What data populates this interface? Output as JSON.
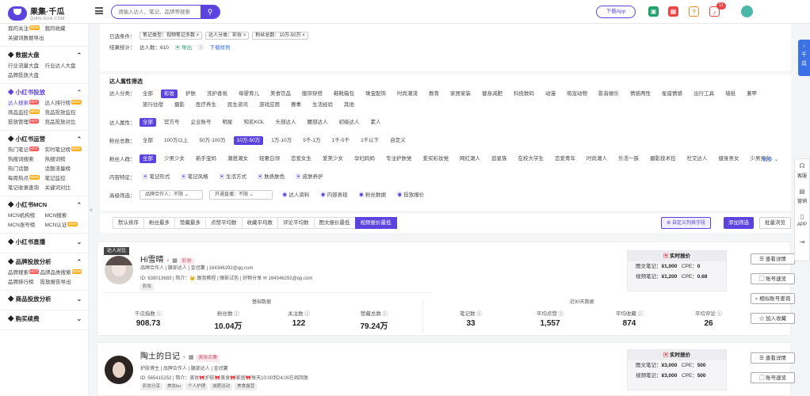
{
  "header": {
    "logo_name": "果集·千瓜",
    "logo_sub": "QIAN-GUA.COM",
    "search_placeholder": "请输入达人、笔记、品牌等搜索",
    "download_app": "下载App",
    "notification_count": "11"
  },
  "sidebar": {
    "groups": [
      {
        "title": "",
        "items": [
          {
            "label": "我的关注",
            "badge": "NEW"
          },
          {
            "label": "我的收藏",
            "badge": ""
          },
          {
            "label": "关键词数据导出",
            "badge": ""
          }
        ]
      },
      {
        "title": "数据大盘",
        "icon": "chart-icon",
        "items": [
          {
            "label": "行业流量大盘",
            "badge": ""
          },
          {
            "label": "行业达人大盘",
            "badge": ""
          },
          {
            "label": "品牌投放大盘",
            "badge": ""
          }
        ]
      },
      {
        "title": "小红书投放",
        "icon": "rocket-icon",
        "active": true,
        "items": [
          {
            "label": "达人搜索",
            "badge": "HOT",
            "active": true
          },
          {
            "label": "达人排行榜",
            "badge": "NEW"
          },
          {
            "label": "商品监控",
            "badge": "NEW"
          },
          {
            "label": "竞品投放监控",
            "badge": ""
          },
          {
            "label": "投放管理",
            "badge": "HOT"
          },
          {
            "label": "竞品投放对比",
            "badge": ""
          }
        ]
      },
      {
        "title": "小红书运营",
        "icon": "notes-icon",
        "items": [
          {
            "label": "热门笔记",
            "badge": "HOT"
          },
          {
            "label": "实时笔记榜",
            "badge": "NEW"
          },
          {
            "label": "热搜词搜索",
            "badge": ""
          },
          {
            "label": "热搜词榜",
            "badge": ""
          },
          {
            "label": "热门话题",
            "badge": ""
          },
          {
            "label": "话题流量榜",
            "badge": ""
          },
          {
            "label": "每周热点",
            "badge": "NEW"
          },
          {
            "label": "笔记监控",
            "badge": ""
          },
          {
            "label": "笔记收录查询",
            "badge": ""
          },
          {
            "label": "关键词对比",
            "badge": ""
          }
        ]
      },
      {
        "title": "小红书MCN",
        "icon": "mcn-icon",
        "items": [
          {
            "label": "MCN机构榜",
            "badge": ""
          },
          {
            "label": "MCN搜索",
            "badge": ""
          },
          {
            "label": "MCN涨号榜",
            "badge": ""
          },
          {
            "label": "MCN认证",
            "badge": "NEW"
          }
        ]
      },
      {
        "title": "小红书直播",
        "icon": "live-icon",
        "items": []
      },
      {
        "title": "品牌投放分析",
        "icon": "brand-icon",
        "items": [
          {
            "label": "品牌搜索",
            "badge": "HOT"
          },
          {
            "label": "品牌品类搜索",
            "badge": "NEW"
          },
          {
            "label": "品牌排行榜",
            "badge": ""
          },
          {
            "label": "投放报告导出",
            "badge": ""
          }
        ]
      },
      {
        "title": "商品投放分析",
        "icon": "goods-icon",
        "items": []
      },
      {
        "title": "购买续费",
        "icon": "cart-icon",
        "items": []
      }
    ]
  },
  "filters": {
    "selected_label": "已选条件：",
    "selected_chips": [
      "笔记类型：视频笔记多数 ×",
      "达人分类：彩妆 ×",
      "粉丝总数：10万-50万 ×"
    ],
    "result_label": "结果统计：",
    "result_text": "达人数：610",
    "export": "导出",
    "download_example": "下载样例",
    "attr_title": "达人属性筛选",
    "category_label": "达人分类：",
    "categories": [
      "全部",
      "彩妆",
      "护肤",
      "洗护香氛",
      "母婴育儿",
      "美食饮品",
      "服饰穿搭",
      "鞋靴箱包",
      "珠宝配饰",
      "时尚潮流",
      "教育",
      "家居家装",
      "健身减肥",
      "科技数码",
      "动漫",
      "萌宠动物",
      "影音娱乐",
      "情感两性",
      "星座情感",
      "出行工具",
      "墙纸",
      "兼甲",
      "旅行住宿",
      "摄影",
      "医疗养生",
      "民生资讯",
      "游戏应用",
      "赛事",
      "生活经验",
      "其他"
    ],
    "attr_label": "达人属性：",
    "attrs": [
      "全部",
      "官方号",
      "企业账号",
      "明星",
      "知名KOL",
      "头部达人",
      "腰部达人",
      "初级达人",
      "素人"
    ],
    "fans_label": "粉丝总数：",
    "fans": [
      "全部",
      "100万以上",
      "50万-100万",
      "10万-50万",
      "1万-10万",
      "5千-1万",
      "1千-5千",
      "1千以下",
      "自定义"
    ],
    "people_label": "粉丝人群：",
    "people": [
      "全部",
      "少男少女",
      "新手宝妈",
      "潮爸潮女",
      "轻奢白领",
      "恋爱女生",
      "爱美少女",
      "孕妇妈妈",
      "专注护肤党",
      "爱买彩妆党",
      "网红潮人",
      "追星族",
      "在校大学生",
      "恋爱青年",
      "时尚潮人",
      "乐活一族",
      "摄影技术控",
      "社交达人",
      "健身男女",
      "少男男女"
    ],
    "more": "更多",
    "content_label": "内容特征：",
    "content": [
      "笔记形式",
      "笔记风格",
      "生活方式",
      "肤质肤色",
      "皮肤养护"
    ],
    "advanced_label": "高级筛选：",
    "adv_dropdowns": [
      "品牌合作人：不限",
      "开通直播：不限"
    ],
    "adv_checks": [
      "达人资料",
      "内容表现",
      "粉丝数据",
      "投放报价"
    ]
  },
  "sort": {
    "tabs": [
      "默认排序",
      "粉丝最多",
      "赞藏最多",
      "点赞平均数",
      "收藏平均数",
      "评论平均数",
      "图文报价最低",
      "视频报价最低"
    ],
    "selected": 7,
    "custom": "自定义列表字段",
    "filter_btn": "添加筛选",
    "batch_btn": "批量浏览"
  },
  "cards": [
    {
      "badge": "达人对比",
      "name": "Hi雪晴",
      "tag": "彩妆",
      "line1": "品牌合作人 | 腰部达人 | 金冠薯 | 164346292@qq.com",
      "line2": "ID: 638013683 | 简介：👑 跟我教程 | 眼影试色 | 好物分享 ✉ 164346292@qq.com",
      "tags": [
        "彩妆"
      ],
      "quote_title": "实时报价",
      "q1_label": "图文笔记：",
      "q1_price": "¥1,000",
      "q1_cpe_label": "CPE：",
      "q1_cpe": "0",
      "q2_label": "视频笔记：",
      "q2_price": "¥1,200",
      "q2_cpe_label": "CPE：",
      "q2_cpe": "0.68",
      "basic_title": "基础数据",
      "recent_title": "近90天数据",
      "stats": [
        {
          "k": "千瓜指数",
          "v": "908.73"
        },
        {
          "k": "粉丝数",
          "v": "10.04万"
        },
        {
          "k": "关注数",
          "v": "122"
        },
        {
          "k": "赞藏总数",
          "v": "79.24万"
        },
        {
          "k": "笔记数",
          "v": "33"
        },
        {
          "k": "平均点赞",
          "v": "1,557"
        },
        {
          "k": "平均收藏",
          "v": "874"
        },
        {
          "k": "平均评论",
          "v": "26"
        }
      ],
      "actions": [
        "查看详情",
        "账号速览",
        "相似账号查询",
        "加入收藏"
      ]
    },
    {
      "name": "陶土的日记",
      "tag": "美妆合集",
      "line1": "护肤博主 | 品牌合作人 | 腰部达人 | 金冠薯",
      "line2": "ID: 565415252 | 简介：美妆🎀护肤🎀美食🎀家居🎀每天10:00到24:00在线回复",
      "tags": [
        "彩妆分享",
        "美妆bu",
        "个人护理",
        "减肥运动",
        "美食露营"
      ],
      "quote_title": "实时报价",
      "q1_label": "图文笔记：",
      "q1_price": "¥3,000",
      "q1_cpe_label": "CPE：",
      "q1_cpe": "500",
      "q2_label": "视频笔记：",
      "q2_price": "¥3,000",
      "q2_cpe_label": "CPE：",
      "q2_cpe": "500",
      "actions": [
        "查看详情",
        "账号速览"
      ]
    }
  ],
  "right_tab": "千瓜",
  "right_tools": [
    "客服",
    "营销",
    "APP"
  ]
}
